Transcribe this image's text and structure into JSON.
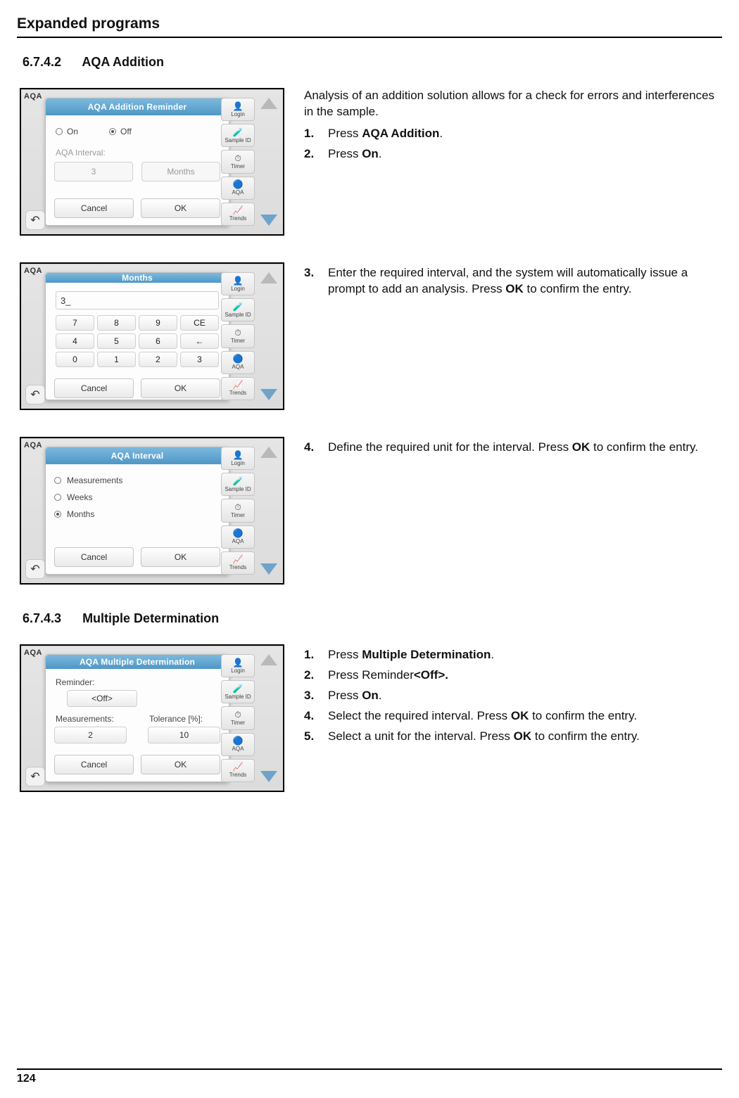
{
  "page": {
    "header": "Expanded programs",
    "number": "124"
  },
  "sections": {
    "s1": {
      "num": "6.7.4.2",
      "title": "AQA Addition"
    },
    "s2": {
      "num": "6.7.4.3",
      "title": "Multiple Determination"
    }
  },
  "sidebar": {
    "aqa_tag": "AQA",
    "items": [
      {
        "icon": "👤",
        "label": "Login"
      },
      {
        "icon": "🧪",
        "label": "Sample ID"
      },
      {
        "icon": "⏱",
        "label": "Timer"
      },
      {
        "icon": "🔵",
        "label": "AQA"
      },
      {
        "icon": "📈",
        "label": "Trends"
      }
    ]
  },
  "dialog_common": {
    "cancel": "Cancel",
    "ok": "OK"
  },
  "thumb1": {
    "title": "AQA Addition Reminder",
    "on": "On",
    "off": "Off",
    "interval_label": "AQA Interval:",
    "interval_value": "3",
    "interval_unit": "Months"
  },
  "thumb2": {
    "title": "Months",
    "input": "3_",
    "keys": [
      "7",
      "8",
      "9",
      "CE",
      "4",
      "5",
      "6",
      "←",
      "0",
      "1",
      "2",
      "3"
    ]
  },
  "thumb3": {
    "title": "AQA Interval",
    "opt1": "Measurements",
    "opt2": "Weeks",
    "opt3": "Months"
  },
  "thumb4": {
    "title": "AQA Multiple Determination",
    "reminder_label": "Reminder:",
    "reminder_value": "<Off>",
    "meas_label": "Measurements:",
    "tol_label": "Tolerance [%]:",
    "meas_value": "2",
    "tol_value": "10"
  },
  "body1": {
    "para": "Analysis of an addition solution allows for a check for errors and interferences in the sample.",
    "s1a": "Press ",
    "s1b": "AQA Addition",
    "s1c": ".",
    "s2a": "Press ",
    "s2b": "On",
    "s2c": "."
  },
  "body2": {
    "s3a": "Enter the required interval, and the system will automatically issue a prompt to add an analysis. Press ",
    "s3b": "OK",
    "s3c": " to confirm the entry."
  },
  "body3": {
    "s4a": "Define the required unit for the interval. Press ",
    "s4b": "OK",
    "s4c": " to confirm the entry."
  },
  "body4": {
    "s1a": "Press ",
    "s1b": "Multiple Determination",
    "s1c": ".",
    "s2a": "Press Reminder",
    "s2b": "<Off>.",
    "s3a": "Press ",
    "s3b": "On",
    "s3c": ".",
    "s4a": "Select the required interval. Press ",
    "s4b": "OK",
    "s4c": " to confirm the entry.",
    "s5a": "Select a unit for the interval. Press ",
    "s5b": "OK",
    "s5c": " to confirm the entry."
  },
  "nums": {
    "n1": "1.",
    "n2": "2.",
    "n3": "3.",
    "n4": "4.",
    "n5": "5."
  }
}
